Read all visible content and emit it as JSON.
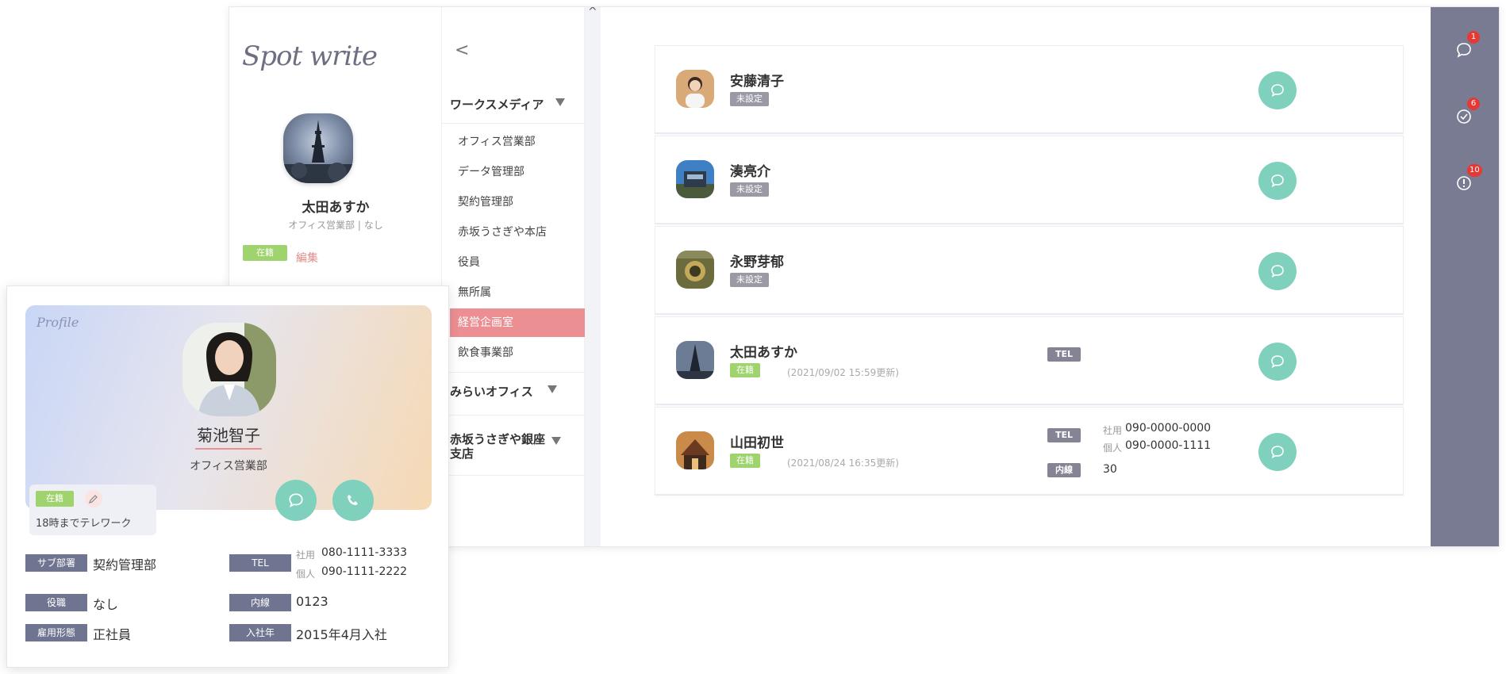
{
  "app": {
    "brand": "Spot write",
    "back_glyph": "<",
    "scroll_up_glyph": "^"
  },
  "me": {
    "name": "太田あすか",
    "subtitle": "オフィス営業部 | なし",
    "status": "在籍",
    "edit_label": "編集"
  },
  "departments": {
    "group1": "ワークスメディア",
    "items": [
      "オフィス営業部",
      "データ管理部",
      "契約管理部",
      "赤坂うさぎや本店",
      "役員",
      "無所属",
      "経営企画室",
      "飲食事業部"
    ],
    "active_index": 6,
    "group2": "みらいオフィス",
    "group3_line1": "赤坂うさぎや銀座",
    "group3_line2": "支店"
  },
  "members": [
    {
      "name": "安藤清子",
      "status": "未設定",
      "status_color": "#9a9aa5"
    },
    {
      "name": "湊亮介",
      "status": "未設定",
      "status_color": "#9a9aa5"
    },
    {
      "name": "永野芽郁",
      "status": "未設定",
      "status_color": "#9a9aa5"
    },
    {
      "name": "太田あすか",
      "status": "在籍",
      "status_color": "#9ed36e",
      "updated": "(2021/09/02 15:59更新)",
      "tel_tag": "TEL"
    },
    {
      "name": "山田初世",
      "status": "在籍",
      "status_color": "#9ed36e",
      "updated": "(2021/08/24 16:35更新)",
      "tel_tag": "TEL",
      "tel_company_label": "社用",
      "tel_company": "090-0000-0000",
      "tel_personal_label": "個人",
      "tel_personal": "090-0000-1111",
      "ext_tag": "内線",
      "ext": "30"
    }
  ],
  "rail": {
    "items": [
      {
        "icon": "chat-icon",
        "count": "1"
      },
      {
        "icon": "check-circle-icon",
        "count": "6"
      },
      {
        "icon": "alert-icon",
        "count": "10"
      }
    ]
  },
  "profile": {
    "script_label": "Profile",
    "name": "菊池智子",
    "dept": "オフィス営業部",
    "status": "在籍",
    "note": "18時までテレワーク",
    "fields": {
      "sub_dept_tag": "サブ部署",
      "sub_dept": "契約管理部",
      "position_tag": "役職",
      "position": "なし",
      "employment_tag": "雇用形態",
      "employment": "正社員",
      "tel_tag": "TEL",
      "tel_company_label": "社用",
      "tel_company": "080-1111-3333",
      "tel_personal_label": "個人",
      "tel_personal": "090-1111-2222",
      "ext_tag": "内線",
      "ext": "0123",
      "joined_tag": "入社年",
      "joined": "2015年4月入社"
    }
  },
  "colors": {
    "accent_teal": "#7fd0bd",
    "active_dept": "#ec8f93",
    "status_green": "#9ed36e",
    "rail_bg": "#797b92",
    "notification_red": "#e53935"
  }
}
